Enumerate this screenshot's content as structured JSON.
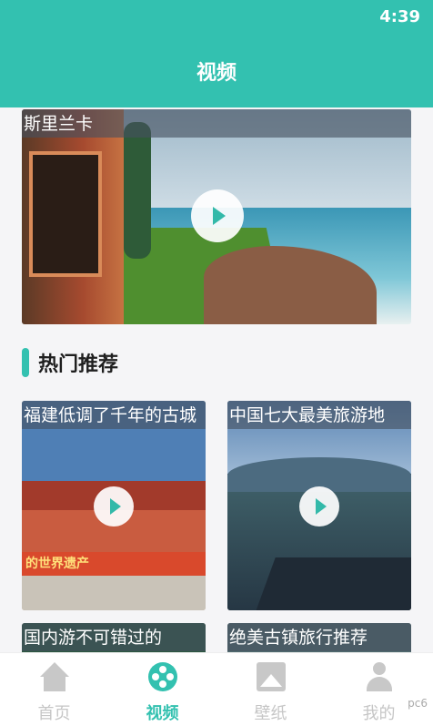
{
  "status": {
    "time": "4:39"
  },
  "header": {
    "title": "视频"
  },
  "hero": {
    "caption": "斯里兰卡"
  },
  "section": {
    "title": "热门推荐"
  },
  "cards": [
    {
      "caption": "福建低调了千年的古城",
      "sign": "的世界遗产"
    },
    {
      "caption": "中国七大最美旅游地"
    },
    {
      "caption": "国内游不可错过的"
    },
    {
      "caption": "绝美古镇旅行推荐"
    }
  ],
  "tabs": [
    {
      "label": "首页",
      "icon": "home-icon"
    },
    {
      "label": "视频",
      "icon": "video-reel-icon",
      "active": true
    },
    {
      "label": "壁纸",
      "icon": "image-icon"
    },
    {
      "label": "我的",
      "icon": "user-icon"
    }
  ],
  "watermark": "pc6",
  "colors": {
    "accent": "#33c1b0"
  }
}
